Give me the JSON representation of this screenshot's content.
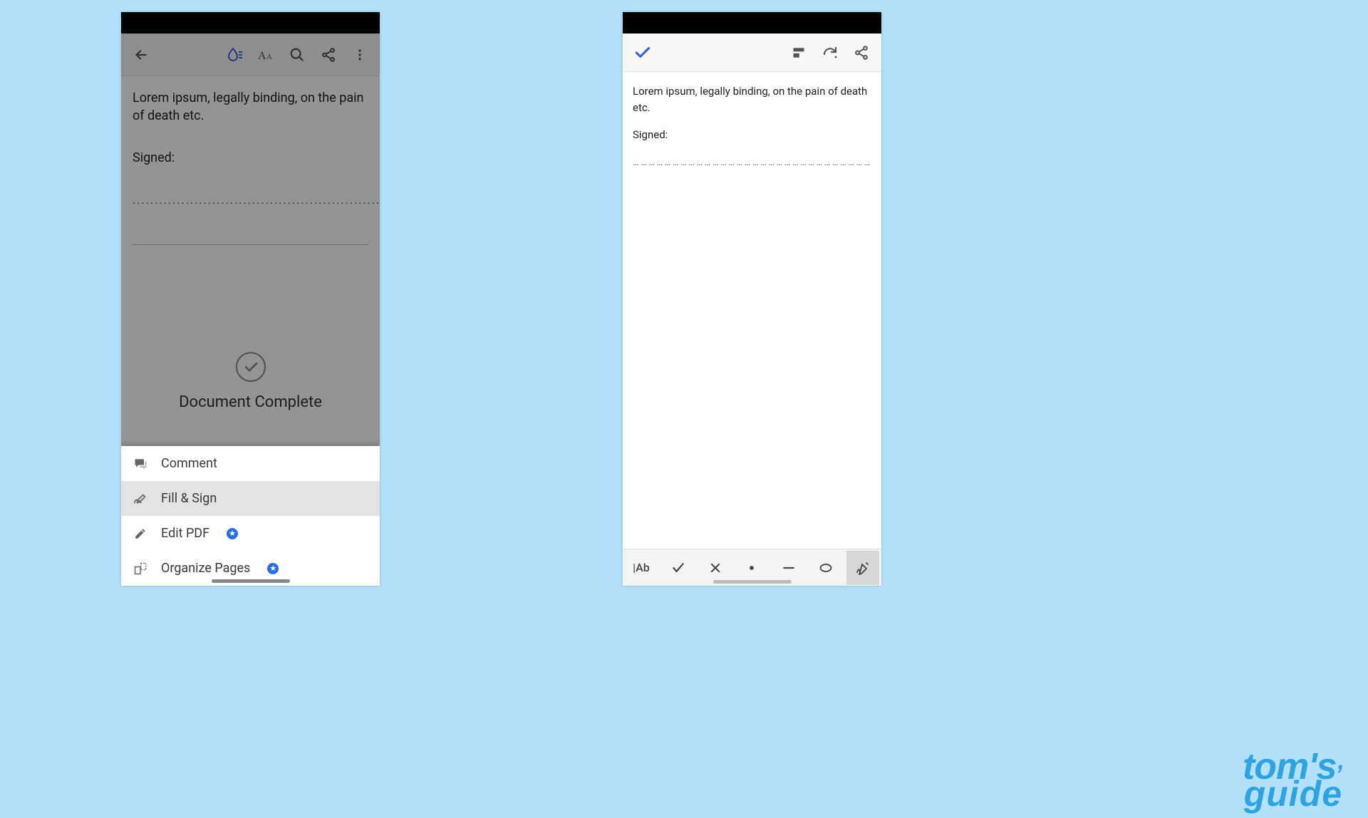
{
  "left": {
    "document": {
      "paragraph": "Lorem ipsum, legally binding, on the pain of death etc.",
      "signed_label": "Signed:",
      "dots": "........................................................................................................................…",
      "status": "Document Complete"
    },
    "sheet": {
      "comment": "Comment",
      "fill_sign": "Fill & Sign",
      "edit_pdf": "Edit PDF",
      "organize": "Organize Pages"
    }
  },
  "right": {
    "document": {
      "paragraph": "Lorem ipsum, legally binding, on the pain of death etc.",
      "signed_label": "Signed:",
      "dotline": "…………………………………………………………………………………………"
    },
    "tools": {
      "text": "|Ab"
    }
  },
  "watermark": {
    "line1": "tom's",
    "line2": "guide"
  }
}
